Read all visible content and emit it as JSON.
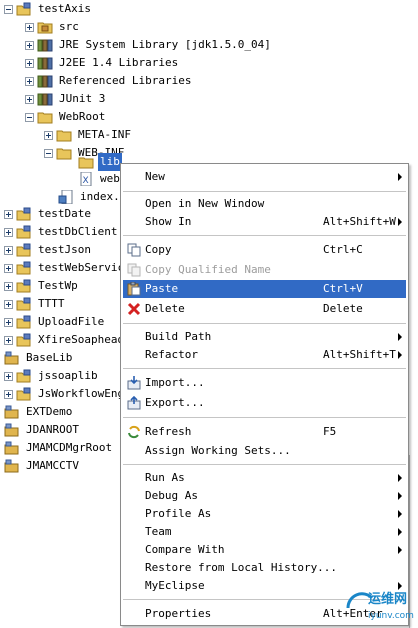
{
  "tree": {
    "items": [
      {
        "label": "testAxis",
        "icon": "project-icon"
      },
      {
        "label": "src",
        "icon": "package-folder-icon"
      },
      {
        "label": "JRE System Library [jdk1.5.0_04]",
        "icon": "library-icon"
      },
      {
        "label": "J2EE 1.4 Libraries",
        "icon": "library-icon"
      },
      {
        "label": "Referenced Libraries",
        "icon": "library-icon"
      },
      {
        "label": "JUnit 3",
        "icon": "library-icon"
      },
      {
        "label": "WebRoot",
        "icon": "folder-icon"
      },
      {
        "label": "META-INF",
        "icon": "folder-icon"
      },
      {
        "label": "WEB-INF",
        "icon": "folder-icon"
      },
      {
        "label": "lib",
        "icon": "folder-icon"
      },
      {
        "label": "web.",
        "icon": "xml-file-icon"
      },
      {
        "label": "index.j",
        "icon": "jsp-file-icon"
      },
      {
        "label": "testDate",
        "icon": "project-icon"
      },
      {
        "label": "testDbClient",
        "icon": "project-icon"
      },
      {
        "label": "testJson",
        "icon": "project-icon"
      },
      {
        "label": "testWebServic",
        "icon": "project-icon"
      },
      {
        "label": "TestWp",
        "icon": "project-icon"
      },
      {
        "label": "TTTT",
        "icon": "project-icon"
      },
      {
        "label": "UploadFile",
        "icon": "project-icon"
      },
      {
        "label": "XfireSoaphead",
        "icon": "project-icon"
      },
      {
        "label": "BaseLib",
        "icon": "closed-project-icon"
      },
      {
        "label": "jssoaplib",
        "icon": "project-icon"
      },
      {
        "label": "JsWorkflowEng",
        "icon": "project-icon"
      },
      {
        "label": "EXTDemo",
        "icon": "closed-project-icon"
      },
      {
        "label": "JDANROOT",
        "icon": "closed-project-icon"
      },
      {
        "label": "JMAMCDMgrRoot",
        "icon": "closed-project-icon"
      },
      {
        "label": "JMAMCCTV",
        "icon": "closed-project-icon"
      }
    ]
  },
  "menu": {
    "items": [
      {
        "label": "New",
        "shortcut": "",
        "submenu": true
      },
      {
        "label": "Open in New Window",
        "shortcut": ""
      },
      {
        "label": "Show In",
        "shortcut": "Alt+Shift+W",
        "submenu": true
      },
      {
        "label": "Copy",
        "shortcut": "Ctrl+C",
        "icon": "copy-icon"
      },
      {
        "label": "Copy Qualified Name",
        "shortcut": "",
        "icon": "copy-qualified-icon",
        "disabled": true
      },
      {
        "label": "Paste",
        "shortcut": "Ctrl+V",
        "icon": "paste-icon",
        "highlighted": true
      },
      {
        "label": "Delete",
        "shortcut": "Delete",
        "icon": "delete-icon"
      },
      {
        "label": "Build Path",
        "shortcut": "",
        "submenu": true
      },
      {
        "label": "Refactor",
        "shortcut": "Alt+Shift+T",
        "submenu": true
      },
      {
        "label": "Import...",
        "shortcut": "",
        "icon": "import-icon"
      },
      {
        "label": "Export...",
        "shortcut": "",
        "icon": "export-icon"
      },
      {
        "label": "Refresh",
        "shortcut": "F5",
        "icon": "refresh-icon"
      },
      {
        "label": "Assign Working Sets...",
        "shortcut": ""
      },
      {
        "label": "Run As",
        "shortcut": "",
        "submenu": true
      },
      {
        "label": "Debug As",
        "shortcut": "",
        "submenu": true
      },
      {
        "label": "Profile As",
        "shortcut": "",
        "submenu": true
      },
      {
        "label": "Team",
        "shortcut": "",
        "submenu": true
      },
      {
        "label": "Compare With",
        "shortcut": "",
        "submenu": true
      },
      {
        "label": "Restore from Local History...",
        "shortcut": ""
      },
      {
        "label": "MyEclipse",
        "shortcut": "",
        "submenu": true
      },
      {
        "label": "Properties",
        "shortcut": "Alt+Enter"
      }
    ]
  },
  "watermark": {
    "brand": "运维网",
    "url": "iyunv.com"
  },
  "colors": {
    "selection": "#316ac5",
    "menu_border": "#8a8a8a",
    "disabled_text": "#9d9d9d"
  }
}
